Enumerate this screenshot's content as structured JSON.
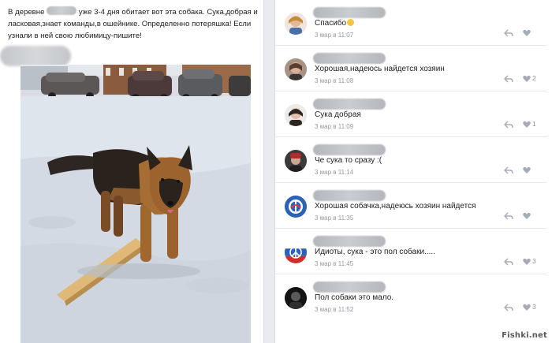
{
  "post": {
    "line1_before": "В деревне",
    "line1_after": "уже 3-4 дня обитает вот эта собака. Сука,добрая и",
    "line2": "ласковая,знает команды,в ошейнике. Определенно потеряшка! Если",
    "line3": "узнали в ней свою любимицу-пишите!"
  },
  "comments": [
    {
      "text": "Спасибо",
      "has_emoji": true,
      "meta": "3 мар в 11:07",
      "likes": ""
    },
    {
      "text": "Хорошая,надеюсь найдется хозяин",
      "has_emoji": false,
      "meta": "3 мар в 11:08",
      "likes": "2"
    },
    {
      "text": "Сука добрая",
      "has_emoji": false,
      "meta": "3 мар в 11:09",
      "likes": "1"
    },
    {
      "text": "Че сука то сразу :(",
      "has_emoji": false,
      "meta": "3 мар в 11:14",
      "likes": ""
    },
    {
      "text": "Хорошая собачка,надеюсь хозяин найдется",
      "has_emoji": false,
      "meta": "3 мар в 11:35",
      "likes": ""
    },
    {
      "text": "Идиоты, сука - это пол собаки.....",
      "has_emoji": false,
      "meta": "3 мар в 11:45",
      "likes": "3"
    },
    {
      "text": "Пол собаки это мало.",
      "has_emoji": false,
      "meta": "3 мар в 11:52",
      "likes": "3"
    }
  ],
  "watermark": "Fishki.net",
  "colors": {
    "meta_gray": "#939aa3",
    "background": "#e9ebee",
    "icon_gray": "#a5acb5"
  },
  "icons": {
    "reply": "reply-arrow-icon",
    "like": "heart-icon"
  }
}
